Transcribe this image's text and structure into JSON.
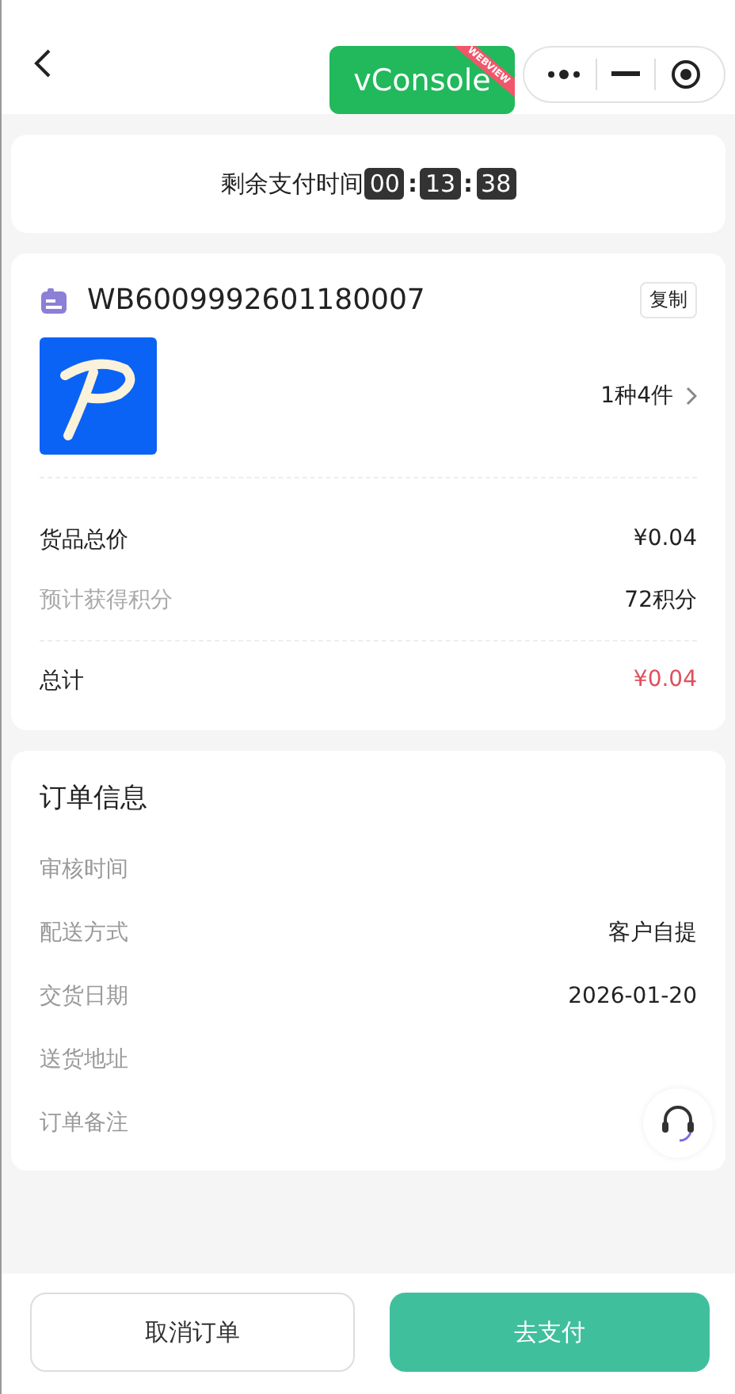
{
  "debug_badge": {
    "label": "vConsole",
    "ribbon": "WEBVIEW"
  },
  "countdown": {
    "label": "剩余支付时间",
    "parts": [
      "00",
      "13",
      "38"
    ],
    "separator": ":"
  },
  "order": {
    "number": "WB6009992601180007",
    "copy_button": "复制",
    "summary": "1种4件",
    "price_rows": [
      {
        "label": "货品总价",
        "value": "¥0.04",
        "kind": "normal"
      },
      {
        "label": "预计获得积分",
        "value": "72积分",
        "kind": "muted"
      },
      {
        "label": "总计",
        "value": "¥0.04",
        "kind": "total"
      }
    ]
  },
  "order_info": {
    "title": "订单信息",
    "rows": [
      {
        "label": "审核时间"
      },
      {
        "label": "配送方式",
        "value": "客户自提"
      },
      {
        "label": "交货日期",
        "value": "2026-01-20"
      },
      {
        "label": "送货地址"
      },
      {
        "label": "订单备注"
      }
    ]
  },
  "buttons": [
    {
      "label": "取消订单",
      "kind": "secondary"
    },
    {
      "label": "去支付",
      "kind": "primary"
    }
  ]
}
